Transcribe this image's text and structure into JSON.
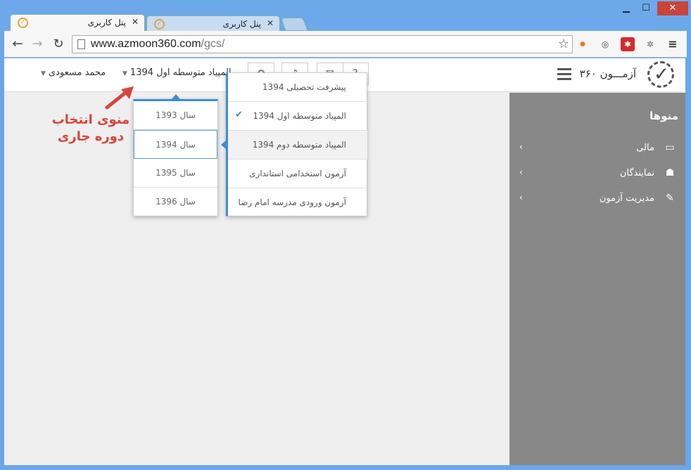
{
  "browser": {
    "tabs": [
      {
        "title": "پنل کاربری",
        "active": true
      },
      {
        "title": "پنل کاربری",
        "active": false
      }
    ],
    "url_host": "www.azmoon360.com",
    "url_path": "/gcs/",
    "window": {
      "minimize": "▁",
      "maximize": "☐",
      "close": "✕"
    }
  },
  "header": {
    "brand": "آزمـــون ۳۶۰",
    "current_period": "المپیاد متوسطه اول 1394",
    "user_name": "محمد مسعودی"
  },
  "sidebar": {
    "title": "منوها",
    "items": [
      {
        "label": "مالی",
        "icon": "credit-card-icon"
      },
      {
        "label": "نمایندگان",
        "icon": "users-icon"
      },
      {
        "label": "مدیریت آزمون",
        "icon": "edit-icon"
      }
    ]
  },
  "period_menu": {
    "items": [
      "پیشرفت تحصیلی 1394",
      "المپیاد متوسطه اول 1394",
      "المپیاد متوسطه دوم 1394",
      "آزمون استخدامی استانداری",
      "آزمون ورودی مدرسه امام رضا"
    ],
    "checked_index": 1,
    "highlighted_index": 2
  },
  "year_menu": {
    "items": [
      "سال 1393",
      "سال 1394",
      "سال 1395",
      "سال 1396"
    ],
    "selected_index": 1
  },
  "annotation": {
    "line1": "منوی انتخاب",
    "line2": "دوره جاری",
    "color": "#d8453a"
  },
  "colors": {
    "accent": "#3a8fd6",
    "sidebar": "#888888"
  }
}
